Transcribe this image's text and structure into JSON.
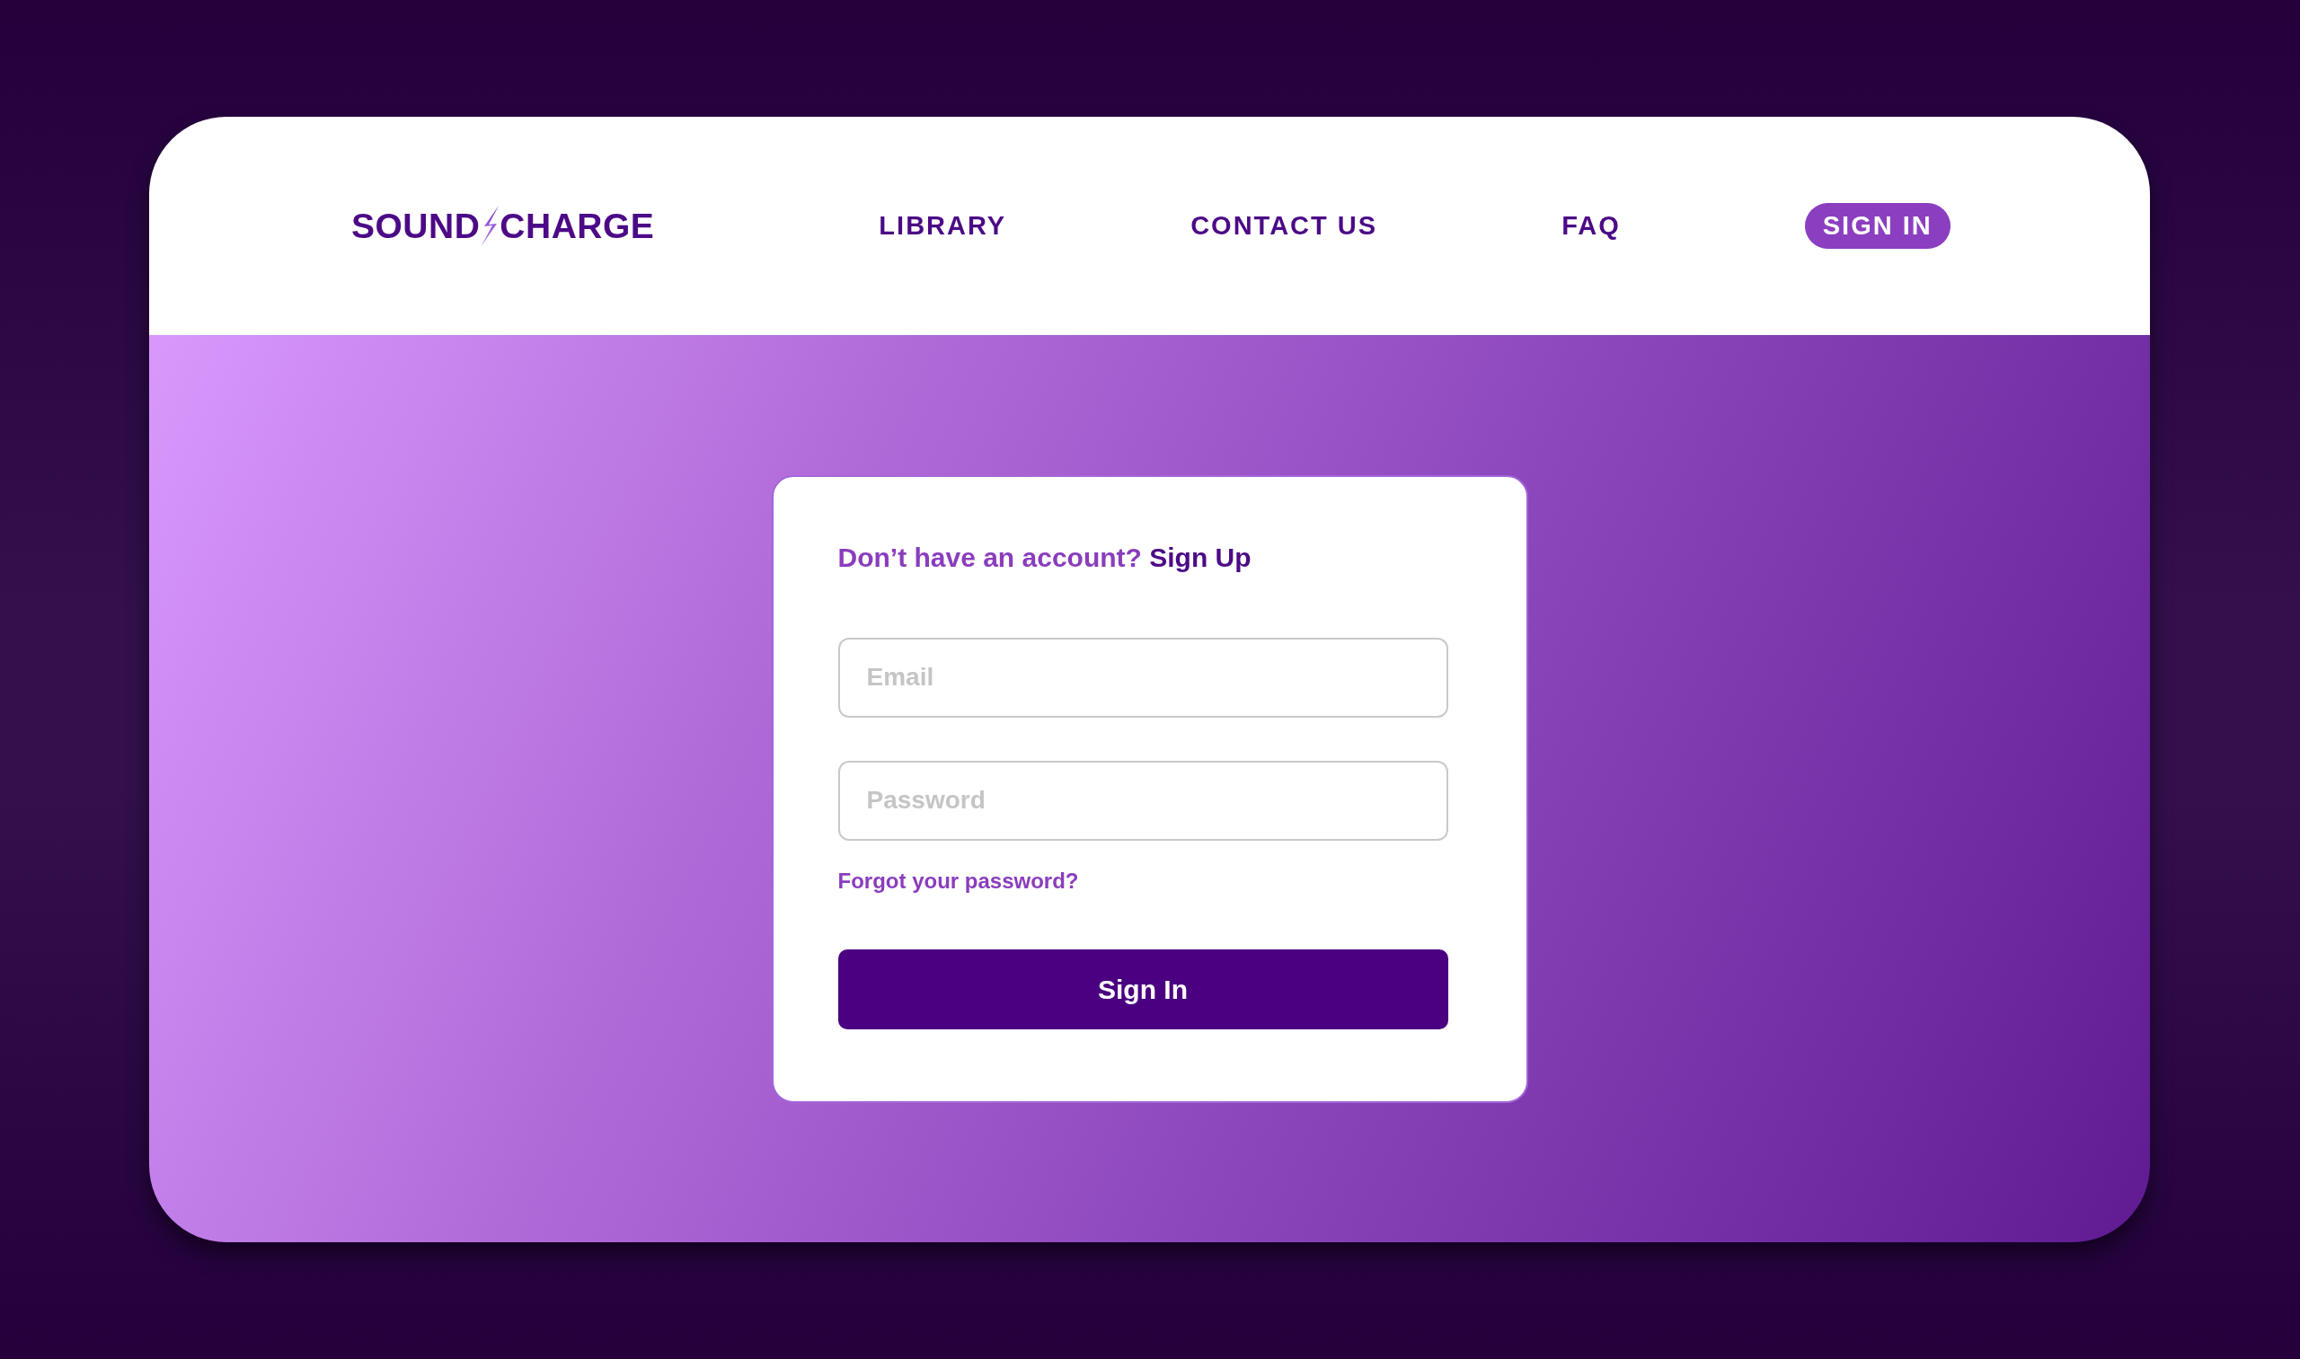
{
  "logo": {
    "text_before": "SOUND",
    "text_after": "CHARGE"
  },
  "nav": {
    "items": [
      {
        "label": "LIBRARY",
        "kind": "link"
      },
      {
        "label": "CONTACT US",
        "kind": "link"
      },
      {
        "label": "FAQ",
        "kind": "link"
      },
      {
        "label": "SIGN IN",
        "kind": "button"
      }
    ]
  },
  "login_card": {
    "prompt": "Don’t have an account?",
    "signup_link": "Sign Up",
    "fields": [
      {
        "placeholder": "Email"
      },
      {
        "placeholder": "Password"
      }
    ],
    "forgot_link": "Forgot your password?",
    "submit": "Sign In"
  }
}
